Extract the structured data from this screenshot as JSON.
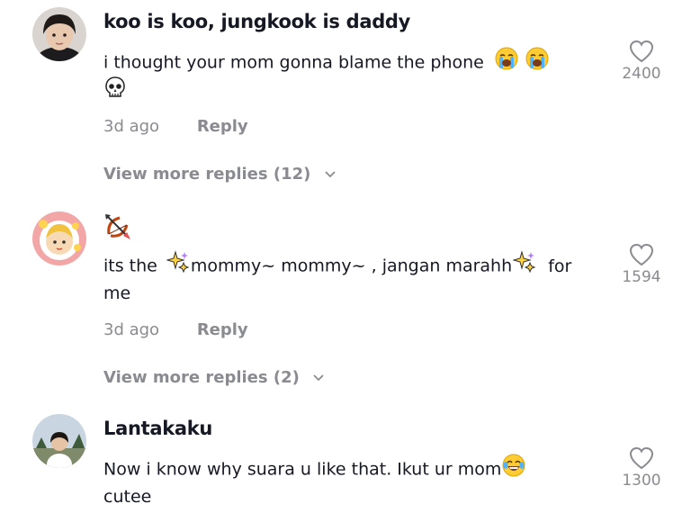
{
  "comments": [
    {
      "username": "koo is koo, jungkook is daddy",
      "text_line1": "i thought your mom gonna blame the phone",
      "text_emojis1": [
        "loudly-crying-face",
        "loudly-crying-face"
      ],
      "text_emoji_line2": "skull",
      "time": "3d ago",
      "reply_label": "Reply",
      "view_more": "View more replies (12)",
      "likes": "2400"
    },
    {
      "username_emoji": "bow-and-arrow",
      "text_prefix": "its the",
      "text_middle": "mommy~ mommy~ , jangan marahh",
      "text_suffix": "for",
      "text_line2": "me",
      "sparkles_icon": "sparkles",
      "time": "3d ago",
      "reply_label": "Reply",
      "view_more": "View more replies (2)",
      "likes": "1594"
    },
    {
      "username": "Lantakaku",
      "text_line1": "Now i know why suara u like that. Ikut ur mom",
      "text_emoji1": "face-with-tears-of-joy",
      "text_line2": "cutee",
      "likes": "1300"
    }
  ],
  "colors": {
    "text": "#161823",
    "muted": "#8a8b91"
  }
}
